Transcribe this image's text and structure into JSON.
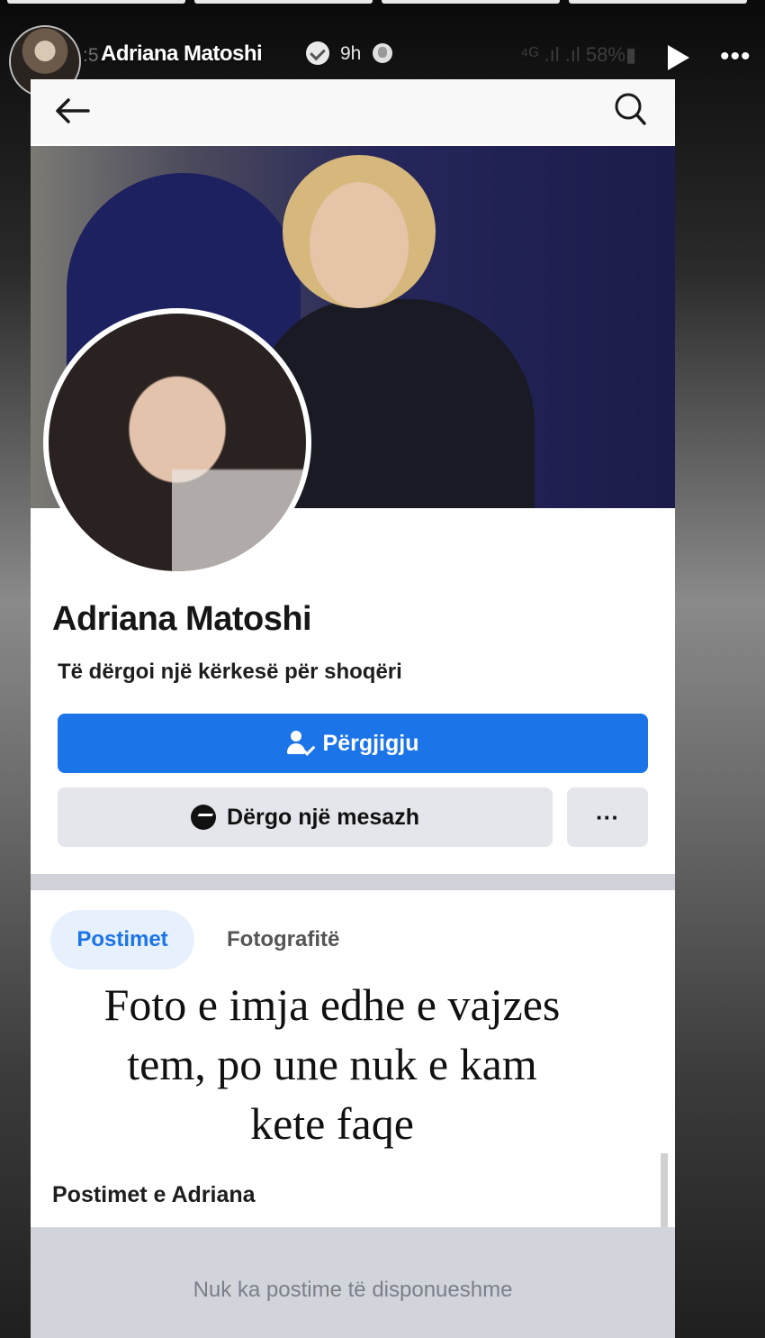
{
  "story": {
    "account_name": "Adriana Matoshi",
    "time_ago": "9h",
    "status_bar_fragment": ":5",
    "signal_battery": "⁴ᴳ .ıl .ıl 58%▮",
    "more_glyph": "•••",
    "progress_segments": 4
  },
  "profile": {
    "name": "Adriana Matoshi",
    "subtitle": "Të dërgoi një kërkesë për shoqëri",
    "respond_label": "Përgjigju",
    "message_label": "Dërgo një mesazh",
    "more_label": "···"
  },
  "tabs": [
    {
      "label": "Postimet",
      "active": true
    },
    {
      "label": "Fotografitë",
      "active": false
    }
  ],
  "caption": {
    "line1": "Foto e imja edhe e vajzes",
    "line2": "tem, po une nuk e kam",
    "line3": "kete faqe"
  },
  "posts": {
    "header": "Postimet e Adriana",
    "empty_text": "Nuk ka postime të disponueshme"
  },
  "colors": {
    "accent": "#1b74e8",
    "button_gray": "#e4e6eb"
  }
}
